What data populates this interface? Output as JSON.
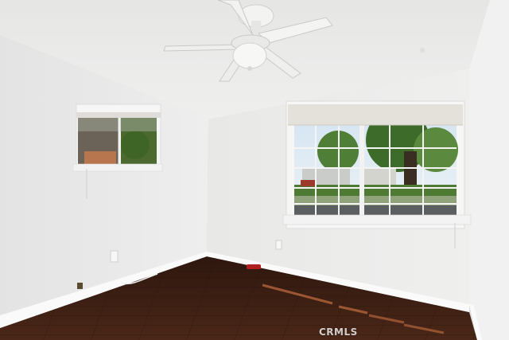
{
  "watermark": {
    "text": "CRMLS"
  },
  "colors": {
    "ceiling": "#ebebea",
    "wall_left": "#e9e9e9",
    "wall_back": "#ececeb",
    "wall_right": "#f1f1f1",
    "floor": "#3b1f14",
    "baseboard": "#fafafa",
    "window_frame": "#f4f4f4"
  },
  "icons": {
    "fan": "ceiling-fan-icon",
    "outlet": "wall-outlet-icon"
  }
}
